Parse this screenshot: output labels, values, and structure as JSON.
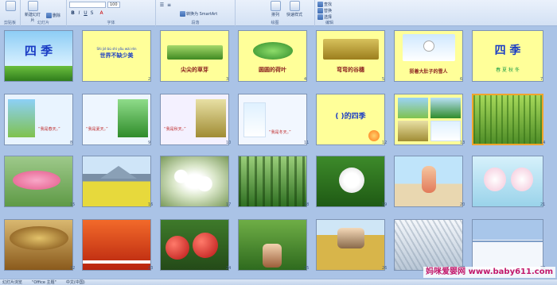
{
  "ribbon": {
    "groups": [
      {
        "label": "剪贴板"
      },
      {
        "label": "幻灯片"
      },
      {
        "label": "字体"
      },
      {
        "label": "段落"
      },
      {
        "label": "绘图"
      },
      {
        "label": "编辑"
      }
    ],
    "new_slide": "新建幻灯片",
    "delete": "删除",
    "font_name": "",
    "font_size": "100",
    "convert_smartart": "转换为 SmartArt",
    "quick_styles": "快速样式",
    "arrange": "排列",
    "find": "查找",
    "replace": "替换",
    "select": "选择"
  },
  "slides": [
    {
      "num": "1",
      "title": "四 季"
    },
    {
      "num": "2",
      "pinyin": "Shì jiè bù shì yǒu wài rén",
      "title": "世界不缺少美"
    },
    {
      "num": "3",
      "title": "尖尖的草芽"
    },
    {
      "num": "4",
      "title": "圆圆的荷叶"
    },
    {
      "num": "5",
      "title": "弯弯的谷穗"
    },
    {
      "num": "6",
      "title": "挺着大肚子的雪人"
    },
    {
      "num": "7",
      "title": "四 季",
      "subtitle": "春 夏 秋 冬"
    },
    {
      "num": "8",
      "quote": "“我是春天。”"
    },
    {
      "num": "9",
      "quote": "“我是夏天。”"
    },
    {
      "num": "10",
      "quote": "“我是秋天。”"
    },
    {
      "num": "11",
      "quote": "“我是冬天。”"
    },
    {
      "num": "12",
      "title": "(   )的四季"
    },
    {
      "num": "13"
    },
    {
      "num": "14"
    },
    {
      "num": "15"
    },
    {
      "num": "16"
    },
    {
      "num": "17"
    },
    {
      "num": "18"
    },
    {
      "num": "19"
    },
    {
      "num": "20"
    },
    {
      "num": "21"
    },
    {
      "num": "22"
    },
    {
      "num": "23"
    },
    {
      "num": "24"
    },
    {
      "num": "25"
    },
    {
      "num": "26"
    },
    {
      "num": "27"
    },
    {
      "num": "28"
    }
  ],
  "status": {
    "slide_count": "幻灯片浏览",
    "theme": "\"Office 主题\"",
    "language": "中文(中国)"
  },
  "watermark": "妈咪爱婴网 www.baby611.com",
  "colors": {
    "accent": "#f0a52c",
    "background": "#aac3e6",
    "slide_yellow": "#ffff99",
    "title_blue": "#1a3cc4"
  }
}
